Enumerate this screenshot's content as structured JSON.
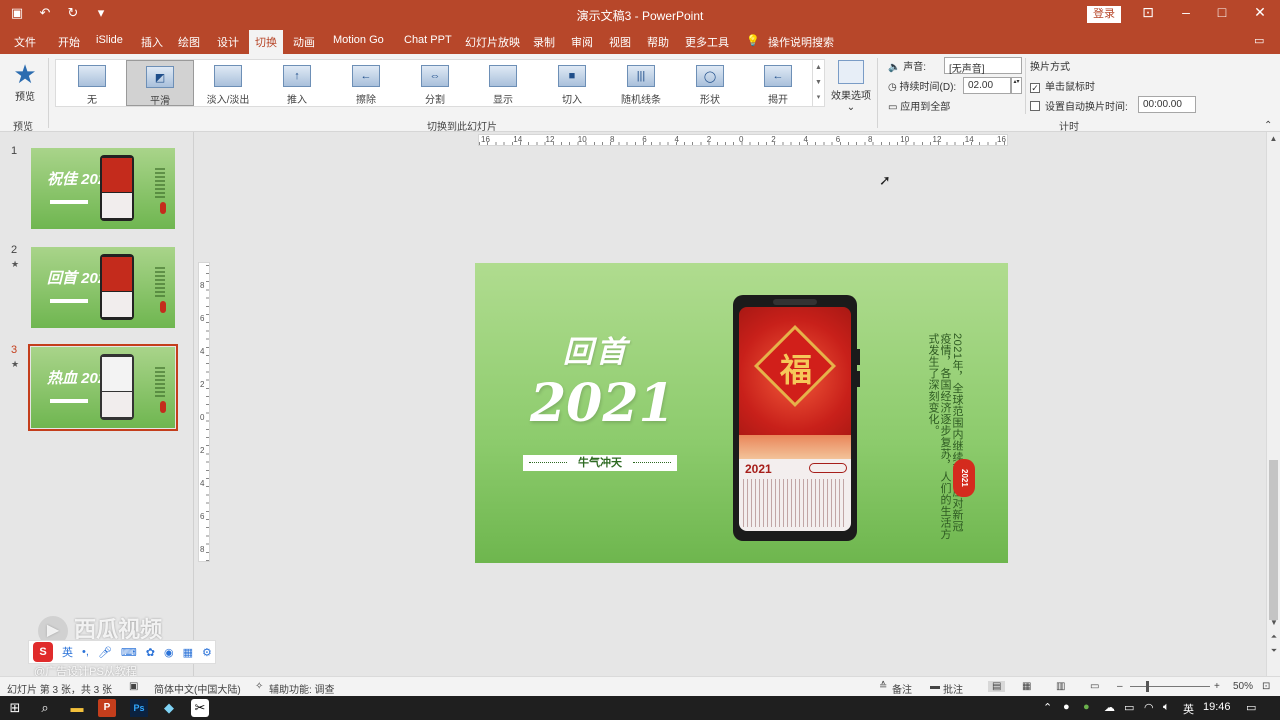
{
  "titlebar": {
    "doc_title": "演示文稿3 - PowerPoint",
    "login": "登录",
    "quick_icons": [
      "save-icon",
      "undo-icon",
      "redo-icon",
      "customize-icon"
    ],
    "window_controls": [
      "ribbon-display-icon",
      "minimize-icon",
      "maximize-icon",
      "close-icon"
    ]
  },
  "menu": {
    "tabs": [
      "文件",
      "开始",
      "iSlide",
      "插入",
      "绘图",
      "设计",
      "切换",
      "动画",
      "Motion Go",
      "Chat PPT",
      "幻灯片放映",
      "录制",
      "审阅",
      "视图",
      "帮助",
      "更多工具"
    ],
    "active": "切换",
    "search": "操作说明搜索"
  },
  "ribbon": {
    "preview_label": "预览",
    "preview_group": "预览",
    "transitions": [
      "无",
      "平滑",
      "淡入/淡出",
      "推入",
      "擦除",
      "分割",
      "显示",
      "切入",
      "随机线条",
      "形状",
      "揭开"
    ],
    "selected_transition": "平滑",
    "effect_options": "效果选项",
    "group_label": "切换到此幻灯片",
    "timing": {
      "sound_label": "声音:",
      "sound_value": "[无声音]",
      "duration_label": "持续时间(D):",
      "duration_value": "02.00",
      "apply_all": "应用到全部",
      "advance_title": "换片方式",
      "on_click": "单击鼠标时",
      "on_click_checked": true,
      "auto_after": "设置自动换片时间:",
      "auto_after_checked": false,
      "auto_value": "00:00.00",
      "group_label": "计时"
    }
  },
  "slides": [
    {
      "num": "1",
      "star": "",
      "title": "祝佳 2026",
      "current": false
    },
    {
      "num": "2",
      "star": "★",
      "title": "回首 2021",
      "current": false
    },
    {
      "num": "3",
      "star": "★",
      "title": "热血 2022",
      "current": true
    }
  ],
  "ruler": {
    "h_labels": [
      "16",
      "14",
      "12",
      "10",
      "8",
      "6",
      "4",
      "2",
      "0",
      "2",
      "4",
      "6",
      "8",
      "10",
      "12",
      "14",
      "16"
    ],
    "v_labels": [
      "8",
      "6",
      "4",
      "2",
      "0",
      "2",
      "4",
      "6",
      "8"
    ]
  },
  "slide": {
    "title1": "回首",
    "title2": "2021",
    "tag": "牛气冲天",
    "phone_year": "2021",
    "phone_char": "福",
    "body_text": "2021年，全球范围内继续积极应对新冠疫情，各国经济逐步复苏，人们的生活方式发生了深刻变化。",
    "seal": "2021"
  },
  "ime": {
    "brand": "S",
    "lang": "英",
    "icons": [
      "punctuation-icon",
      "mic-icon",
      "keyboard-icon",
      "skin-icon",
      "game-icon",
      "toolbox-icon",
      "settings-icon"
    ]
  },
  "watermark": {
    "line1": "西瓜视频",
    "line2": "@广告设计PS从教程"
  },
  "status": {
    "slide_info": "幻灯片 第 3 张，共 3 张",
    "language": "简体中文(中国大陆)",
    "accessibility": "辅助功能: 调查",
    "notes": "备注",
    "comments": "批注",
    "zoom": "50%",
    "zoom_fraction": 0.5
  },
  "taskbar": {
    "clock": "19:46",
    "ime": "英",
    "apps": [
      "windows-icon",
      "search-icon",
      "explorer-icon",
      "powerpoint-icon",
      "photoshop-icon",
      "app-icon",
      "capcut-icon"
    ]
  },
  "colors": {
    "brand": "#b7472a",
    "slide_green": "#8ccb6c",
    "current_slide": "#c43e1c"
  }
}
